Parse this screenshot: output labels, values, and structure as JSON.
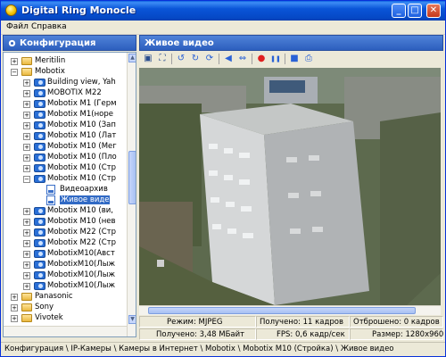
{
  "window": {
    "title": "Digital Ring Monocle",
    "colors": {
      "titlebar": "#0a55d8",
      "panel_header": "#2d5fbe",
      "selection": "#316ac5",
      "record": "#e02020"
    }
  },
  "menu": {
    "items": [
      "Файл",
      "Справка"
    ]
  },
  "left_panel": {
    "header": "Конфигурация",
    "tree": [
      {
        "label": "Meritilin",
        "type": "folder",
        "level": 1,
        "expanded": false
      },
      {
        "label": "Mobotix",
        "type": "folder",
        "level": 1,
        "expanded": true
      },
      {
        "label": "Building view, Yah",
        "type": "camera",
        "level": 2,
        "expanded": false
      },
      {
        "label": "MOBOTIX M22",
        "type": "camera",
        "level": 2,
        "expanded": false
      },
      {
        "label": "Mobotix M1 (Герм",
        "type": "camera",
        "level": 2,
        "expanded": false
      },
      {
        "label": "Mobotix M1(норе",
        "type": "camera",
        "level": 2,
        "expanded": false
      },
      {
        "label": "Mobotix M10 (Зап",
        "type": "camera",
        "level": 2,
        "expanded": false
      },
      {
        "label": "Mobotix M10 (Лат",
        "type": "camera",
        "level": 2,
        "expanded": false
      },
      {
        "label": "Mobotix M10 (Мег",
        "type": "camera",
        "level": 2,
        "expanded": false
      },
      {
        "label": "Mobotix M10 (Пло",
        "type": "camera",
        "level": 2,
        "expanded": false
      },
      {
        "label": "Mobotix M10 (Стр",
        "type": "camera",
        "level": 2,
        "expanded": false
      },
      {
        "label": "Mobotix M10 (Стр",
        "type": "camera",
        "level": 2,
        "expanded": true
      },
      {
        "label": "Видеоархив",
        "type": "archive",
        "level": 3
      },
      {
        "label": "Живое виде",
        "type": "live",
        "level": 3,
        "selected": true
      },
      {
        "label": "Mobotix M10 (ви,",
        "type": "camera",
        "level": 2,
        "expanded": false
      },
      {
        "label": "Mobotix M10 (нев",
        "type": "camera",
        "level": 2,
        "expanded": false
      },
      {
        "label": "Mobotix M22 (Стр",
        "type": "camera",
        "level": 2,
        "expanded": false
      },
      {
        "label": "Mobotix M22 (Стр",
        "type": "camera",
        "level": 2,
        "expanded": false
      },
      {
        "label": "MobotixM10(Авст",
        "type": "camera",
        "level": 2,
        "expanded": false
      },
      {
        "label": "MobotixM10(Лыж",
        "type": "camera",
        "level": 2,
        "expanded": false
      },
      {
        "label": "MobotixM10(Лыж",
        "type": "camera",
        "level": 2,
        "expanded": false
      },
      {
        "label": "MobotixM10(Лыж",
        "type": "camera",
        "level": 2,
        "expanded": false
      },
      {
        "label": "Panasonic",
        "type": "folder",
        "level": 1,
        "expanded": false
      },
      {
        "label": "Sony",
        "type": "folder",
        "level": 1,
        "expanded": false
      },
      {
        "label": "Vivotek",
        "type": "folder",
        "level": 1,
        "expanded": false
      }
    ]
  },
  "right_panel": {
    "header": "Живое видео",
    "toolbar": [
      {
        "name": "fit-window-icon",
        "color": "#2a4d8f"
      },
      {
        "name": "fullscreen-icon",
        "color": "#2a4d8f"
      },
      {
        "sep": true
      },
      {
        "name": "rotate-left-icon",
        "color": "#2a62d6"
      },
      {
        "name": "rotate-right-icon",
        "color": "#2a62d6"
      },
      {
        "name": "refresh-icon",
        "color": "#2a62d6"
      },
      {
        "sep": true
      },
      {
        "name": "flip-icon",
        "color": "#2a62d6"
      },
      {
        "name": "mirror-icon",
        "color": "#2a62d6"
      },
      {
        "sep": true
      },
      {
        "name": "record-icon",
        "color": "#e02020"
      },
      {
        "name": "pause-icon",
        "color": "#2a62d6"
      },
      {
        "sep": true
      },
      {
        "name": "save-icon",
        "color": "#2a62d6"
      },
      {
        "name": "print-icon",
        "color": "#2a62d6"
      }
    ]
  },
  "status": {
    "mode": "Режим: MJPEG",
    "received_frames": "Получено: 11 кадров",
    "dropped_frames": "Отброшено: 0 кадров",
    "received_bytes": "Получено: 3,48 МБайт",
    "fps": "FPS: 0,6 кадр/сек",
    "size": "Размер: 1280x960"
  },
  "footer": {
    "breadcrumb": "Конфигурация \\ IP-Камеры \\ Камеры в Интернет \\ Mobotix \\ Mobotix M10 (Стройка) \\ Живое видео"
  }
}
